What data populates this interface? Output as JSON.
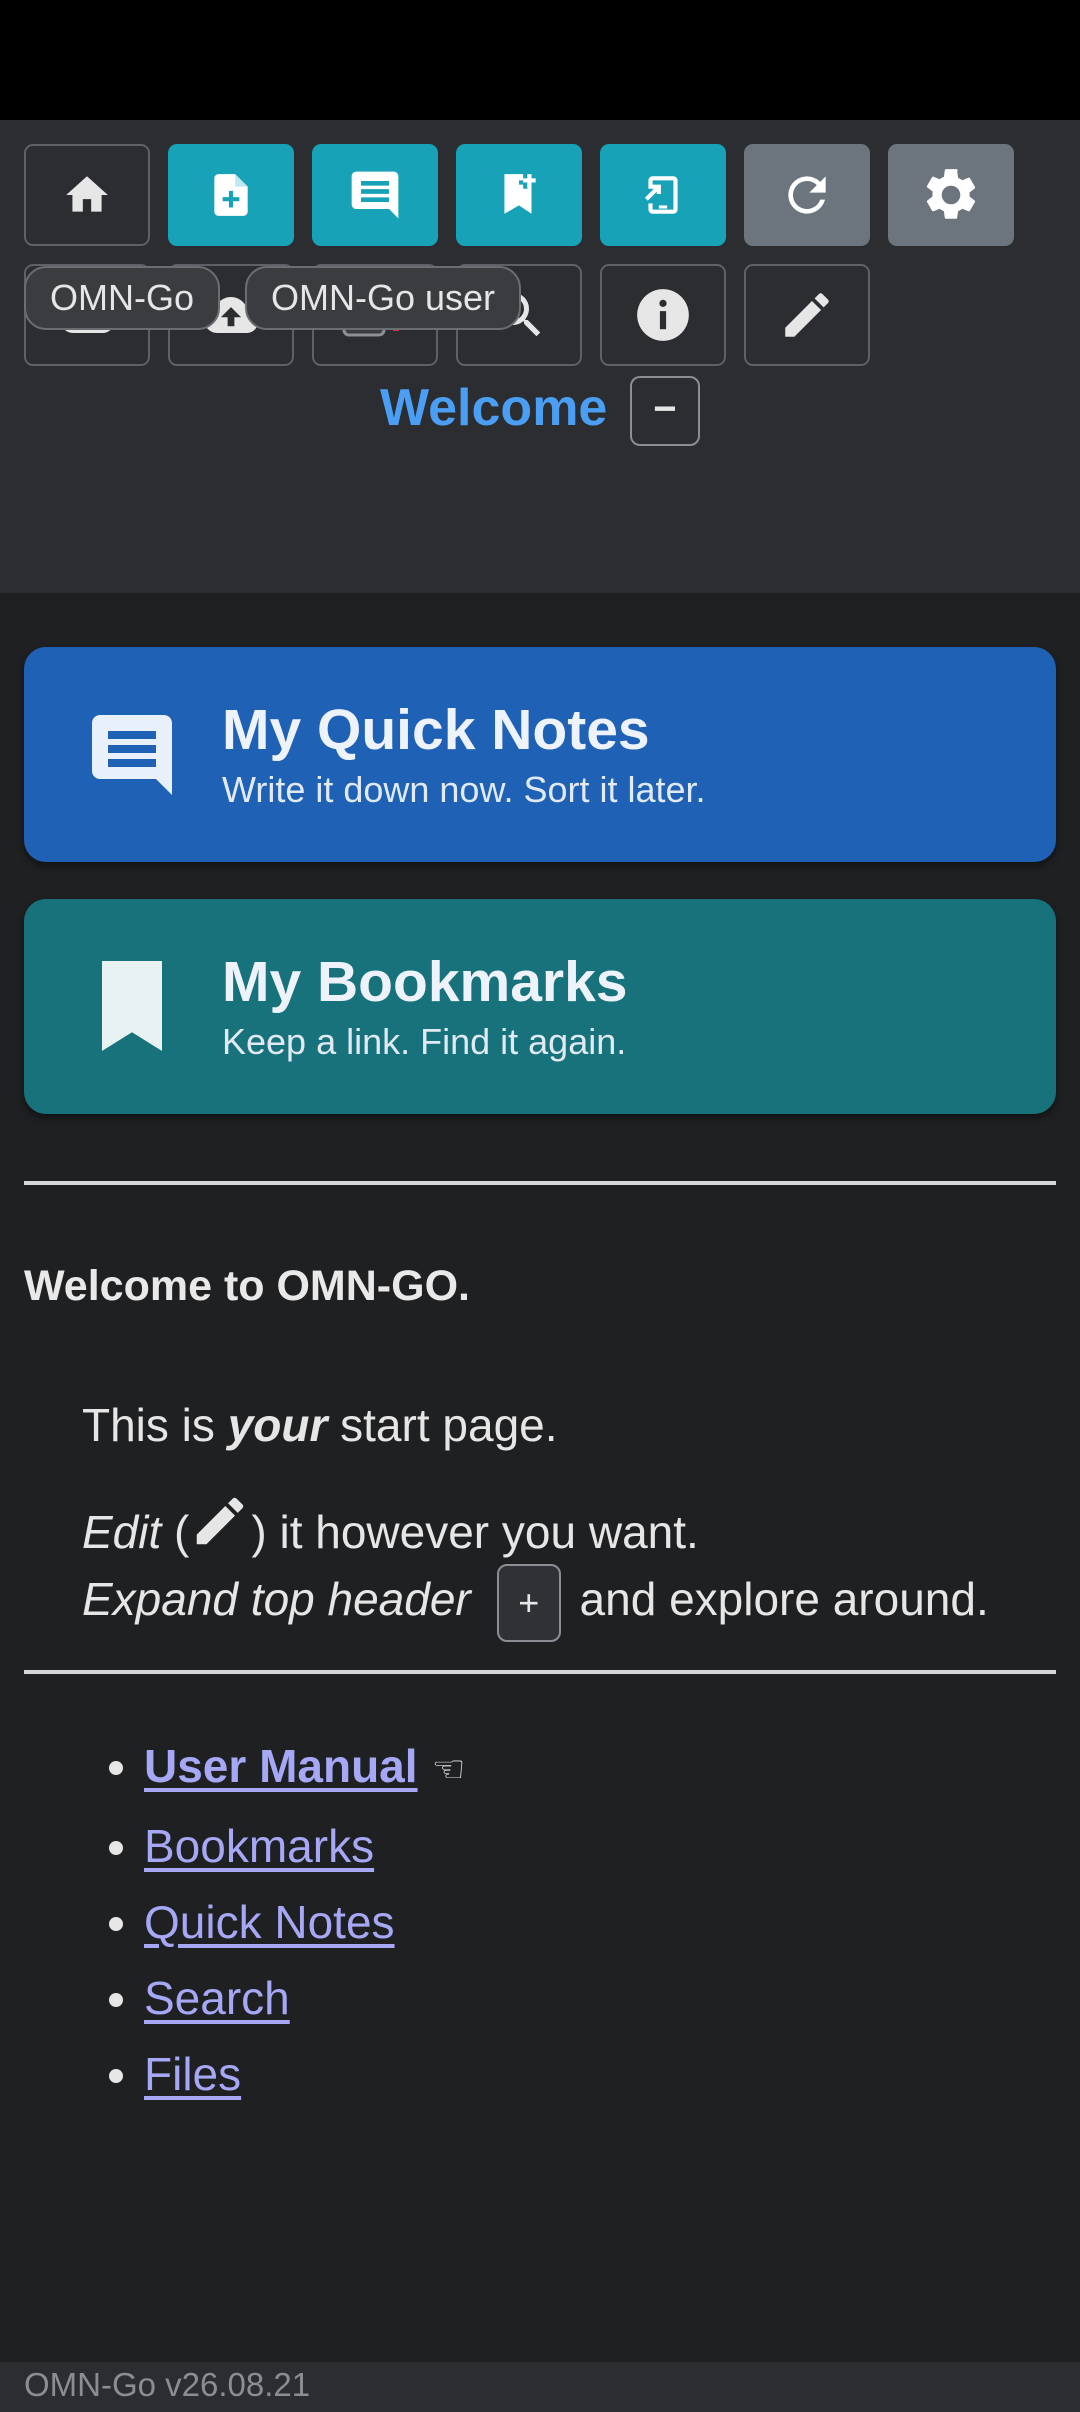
{
  "header": {
    "toolbar_row1": [
      {
        "icon": "home-icon"
      },
      {
        "icon": "file-plus-icon",
        "color": "#17a2b8"
      },
      {
        "icon": "quick-note-icon",
        "color": "#17a2b8"
      },
      {
        "icon": "bookmark-plus-icon",
        "color": "#17a2b8"
      },
      {
        "icon": "mobile-share-icon",
        "color": "#17a2b8"
      },
      {
        "icon": "refresh-icon",
        "color": "#6c757d"
      },
      {
        "icon": "settings-gear-icon",
        "color": "#6c757d"
      }
    ],
    "toolbar_row2": [
      {
        "icon": "cloud-download-icon"
      },
      {
        "icon": "cloud-upload-icon"
      },
      {
        "icon": "unsaved-alert-icon",
        "alert_text": "!"
      },
      {
        "icon": "search-icon"
      },
      {
        "icon": "info-icon"
      },
      {
        "icon": "edit-pencil-icon"
      }
    ],
    "pills": [
      "OMN-Go",
      "OMN-Go user"
    ],
    "page_title": "Welcome",
    "collapse_label": "−"
  },
  "cards": [
    {
      "title": "My Quick Notes",
      "subtitle": "Write it down now. Sort it later.",
      "icon": "quick-note-icon",
      "color": "#1f62b5"
    },
    {
      "title": "My Bookmarks",
      "subtitle": "Keep a link. Find it again.",
      "icon": "bookmark-icon",
      "color": "#17727c"
    }
  ],
  "content": {
    "heading": "Welcome to OMN-GO.",
    "line1": {
      "a": "This is ",
      "b": "your",
      "c": " start page."
    },
    "line2": {
      "a": "Edit",
      "b": " (",
      "c": ") it however you want."
    },
    "line3": {
      "a": "Expand top header",
      "b": "+",
      "c": " and explore around."
    }
  },
  "links": [
    {
      "label": "User Manual",
      "bold": true,
      "trailing_icon": "pointing-hand-icon"
    },
    {
      "label": "Bookmarks"
    },
    {
      "label": "Quick Notes"
    },
    {
      "label": "Search"
    },
    {
      "label": "Files"
    }
  ],
  "footer": {
    "version": "OMN-Go v26.08.21"
  },
  "colors": {
    "accent": "#4a9ff5",
    "link": "#a6a7f5",
    "background": "#1f2022",
    "header": "#2b2d30"
  }
}
